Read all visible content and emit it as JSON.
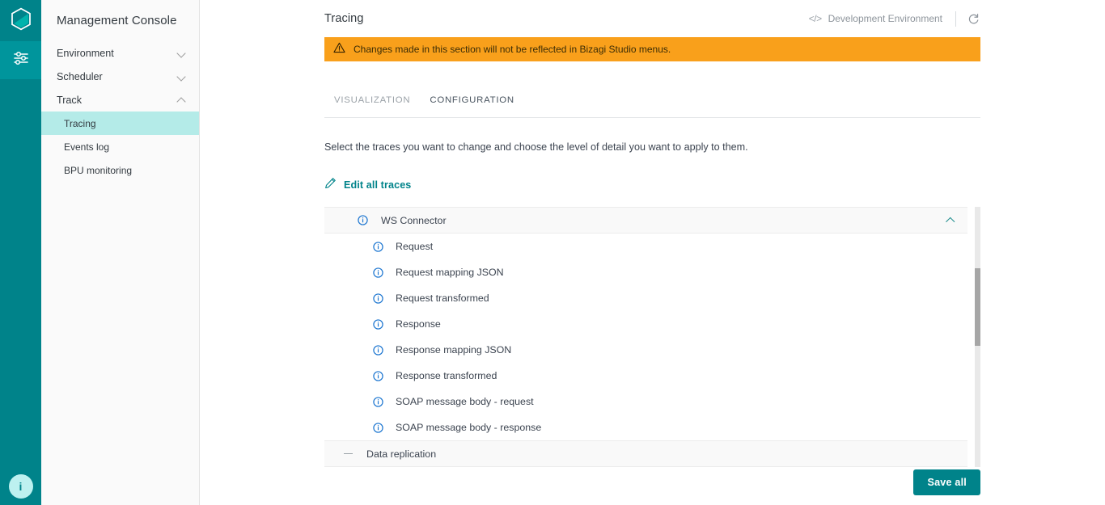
{
  "rail": {
    "logo_icon": "bizagi-hexagon-logo",
    "items": [
      {
        "icon": "sliders-settings-icon",
        "active": true
      }
    ],
    "help_label": "i"
  },
  "sidebar": {
    "title": "Management Console",
    "groups": [
      {
        "label": "Environment",
        "chevron": "chevron-down-icon",
        "expanded": false
      },
      {
        "label": "Scheduler",
        "chevron": "chevron-down-icon",
        "expanded": false
      },
      {
        "label": "Track",
        "chevron": "chevron-up-icon",
        "expanded": true
      }
    ],
    "track_items": [
      {
        "label": "Tracing",
        "active": true
      },
      {
        "label": "Events log",
        "active": false
      },
      {
        "label": "BPU monitoring",
        "active": false
      }
    ]
  },
  "header": {
    "title": "Tracing",
    "env_icon": "code-brackets-icon",
    "env_label": "Development Environment",
    "refresh_icon": "refresh-icon"
  },
  "banner": {
    "icon": "warning-triangle-icon",
    "text": "Changes made in this section will not be reflected in Bizagi Studio menus.",
    "color": "#f9a01b"
  },
  "tabs": [
    {
      "label": "VISUALIZATION",
      "selected": false
    },
    {
      "label": "CONFIGURATION",
      "selected": true
    }
  ],
  "content": {
    "instruction": "Select the traces you want to change and choose the level of detail you want to apply to them.",
    "edit_all": {
      "icon": "pencil-edit-icon",
      "label": "Edit all traces"
    }
  },
  "traces": {
    "groups": [
      {
        "label": "WS Connector",
        "icon": "info-circle-icon",
        "expanded": true,
        "toggle_icon": "chevron-up-icon",
        "children": [
          {
            "label": "Request",
            "icon": "info-circle-icon"
          },
          {
            "label": "Request mapping JSON",
            "icon": "info-circle-icon"
          },
          {
            "label": "Request transformed",
            "icon": "info-circle-icon"
          },
          {
            "label": "Response",
            "icon": "info-circle-icon"
          },
          {
            "label": "Response mapping JSON",
            "icon": "info-circle-icon"
          },
          {
            "label": "Response transformed",
            "icon": "info-circle-icon"
          },
          {
            "label": "SOAP message body - request",
            "icon": "info-circle-icon"
          },
          {
            "label": "SOAP message body - response",
            "icon": "info-circle-icon"
          }
        ]
      },
      {
        "label": "Data replication",
        "icon": "dash-icon",
        "expanded": false,
        "toggle_icon": "",
        "children": []
      }
    ]
  },
  "footer": {
    "save_label": "Save all"
  },
  "colors": {
    "brand_teal": "#00838a",
    "rail_active": "#00959c",
    "sidebar_active": "#b4ebe8",
    "warning": "#f9a01b",
    "info_blue": "#1b75d0"
  }
}
